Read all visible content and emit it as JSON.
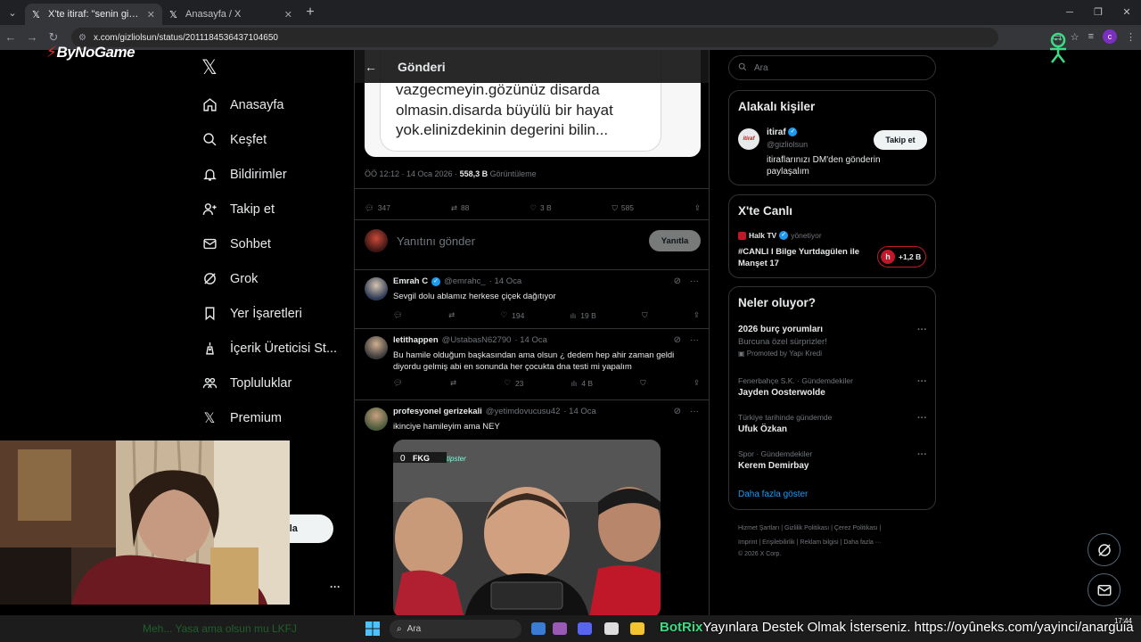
{
  "browser": {
    "tabs": [
      {
        "title": "X'te itiraf: \"senin gibi iyi insanla",
        "active": true
      },
      {
        "title": "Anasayfa / X",
        "active": false
      }
    ],
    "url": "x.com/gizliolsun/status/2011184536437104650"
  },
  "overlay": {
    "logo_text": "ByNoGame"
  },
  "nav": {
    "items": [
      {
        "label": "Anasayfa",
        "icon": "home-icon"
      },
      {
        "label": "Keşfet",
        "icon": "search-icon"
      },
      {
        "label": "Bildirimler",
        "icon": "bell-icon"
      },
      {
        "label": "Takip et",
        "icon": "add-user-icon"
      },
      {
        "label": "Sohbet",
        "icon": "mail-icon"
      },
      {
        "label": "Grok",
        "icon": "grok-icon"
      },
      {
        "label": "Yer İşaretleri",
        "icon": "bookmark-icon"
      },
      {
        "label": "İçerik Üreticisi St...",
        "icon": "creator-icon"
      },
      {
        "label": "Topluluklar",
        "icon": "communities-icon"
      },
      {
        "label": "Premium",
        "icon": "x-icon"
      }
    ],
    "post_button_partial": "nla"
  },
  "header": {
    "title": "Gönderi"
  },
  "post": {
    "image_text": "vazgecmeyin.gözünüz disarda\nolmasin.disarda büyülü bir hayat\nyok.elinizdekinin degerini bilin...",
    "time": "ÖÖ 12:12 · 14 Oca 2026 ·",
    "views": "558,3 B",
    "views_label": "Görüntüleme",
    "stats": {
      "replies": "347",
      "reposts": "88",
      "likes": "3 B",
      "bookmarks": "585"
    }
  },
  "reply_box": {
    "placeholder": "Yanıtını gönder",
    "button": "Yanıtla"
  },
  "replies": [
    {
      "name": "Emrah C",
      "handle": "@emrahc_",
      "date": "· 14 Oca",
      "text": "Sevgil dolu ablamız herkese çiçek dağıtıyor",
      "replies": "",
      "reposts": "",
      "likes": "194",
      "views": "19 B",
      "verified": true
    },
    {
      "name": "letithappen",
      "handle": "@UstabasN62790",
      "date": "· 14 Oca",
      "text": "Bu hamile olduğum başkasından ama olsun ¿ dedem hep ahir zaman geldi diyordu gelmiş abi en sonunda her çocukta dna testi mi yapalım",
      "replies": "",
      "reposts": "",
      "likes": "23",
      "views": "4 B",
      "verified": false
    },
    {
      "name": "profesyonel gerizekali",
      "handle": "@yetimdovucusu42",
      "date": "· 14 Oca",
      "text": "ikinciye hamileyim ama NEY",
      "verified": false
    }
  ],
  "media": {
    "score_left": "0",
    "team": "FKG",
    "sponsor": "tipster"
  },
  "sidebar": {
    "search_placeholder": "Ara",
    "related": {
      "title": "Alakalı kişiler",
      "name": "itiraf",
      "handle": "@gizliolsun",
      "bio": "itiraflarınızı DM'den gönderin paylaşalım",
      "follow": "Takip et",
      "avatar_text": "itiraf"
    },
    "live": {
      "title": "X'te Canlı",
      "host": "Halk TV",
      "host_role": "yönetiyor",
      "topic": "#CANLI I Bilge Yurtdagülen ile Manşet 17",
      "listeners": "+1,2 B"
    },
    "happening": {
      "title": "Neler oluyor?",
      "trends": [
        {
          "name": "2026 burç yorumları",
          "sub": "Burcuna özel sürprizler!",
          "promo": "Promoted by Yapı Kredi"
        },
        {
          "category": "Fenerbahçe S.K. · Gündemdekiler",
          "name": "Jayden Oosterwolde"
        },
        {
          "category": "Türkiye tarihinde gündemde",
          "name": "Ufuk Özkan"
        },
        {
          "category": "Spor · Gündemdekiler",
          "name": "Kerem Demirbay"
        }
      ],
      "show_more": "Daha fazla göster"
    },
    "footer": {
      "line1": [
        "Hizmet Şartları",
        "Gizlilik Politikası",
        "Çerez Politikası"
      ],
      "line2": [
        "Imprint",
        "Erişilebilirlik",
        "Reklam bilgisi",
        "Daha fazla ···"
      ],
      "copyright": "© 2026 X Corp."
    }
  },
  "taskbar": {
    "search": "Ara",
    "ticker": "Meh... Yasa ama olsun mu LKFJ",
    "botrix_name": "BotRix",
    "botrix_text": "Yayınlara Destek Olmak İsterseniz. https://oyûneks.com/yayinci/anarguia",
    "time": "17:44"
  },
  "colors": {
    "accent": "#1d9bf0",
    "background": "#000000",
    "border": "#2f3336",
    "muted": "#71767b"
  }
}
